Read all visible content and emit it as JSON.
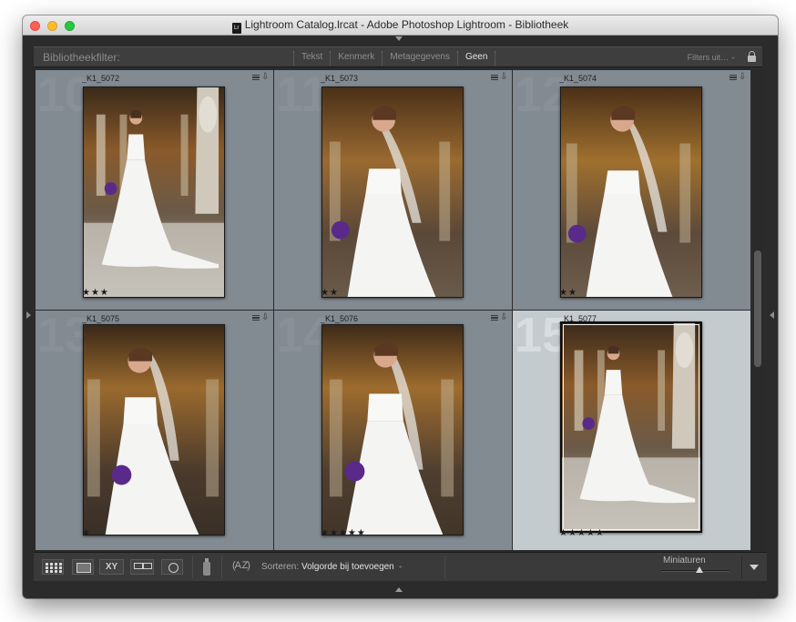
{
  "window": {
    "title": "Lightroom Catalog.lrcat - Adobe Photoshop Lightroom - Bibliotheek",
    "doc_icon_text": "Lr"
  },
  "filter_bar": {
    "label": "Bibliotheekfilter:",
    "tabs": [
      "Tekst",
      "Kenmerk",
      "Metagegevens",
      "Geen"
    ],
    "active_tab": "Geen",
    "filters_off": "Filters uit",
    "filters_off_arrow": "÷",
    "lock_icon": "padlock-icon"
  },
  "grid": {
    "cells": [
      {
        "index": "10",
        "name": "_K1_5072",
        "rating": 3,
        "stars": "★★★",
        "selected": false
      },
      {
        "index": "11",
        "name": "_K1_5073",
        "rating": 2,
        "stars": "★★",
        "selected": false
      },
      {
        "index": "12",
        "name": "_K1_5074",
        "rating": 2,
        "stars": "★★",
        "selected": false
      },
      {
        "index": "13",
        "name": "_K1_5075",
        "rating": 1,
        "stars": "★",
        "selected": false
      },
      {
        "index": "14",
        "name": "_K1_5076",
        "rating": 5,
        "stars": "★★★★★",
        "selected": false
      },
      {
        "index": "15",
        "name": "_K1_5077",
        "rating": 5,
        "stars": "★★★★★",
        "selected": true
      }
    ],
    "badge_arrow": "⇩"
  },
  "toolbar": {
    "compare_label": "XY",
    "sort_icon_text": "A Z",
    "sort_label": "Sorteren:",
    "sort_value": "Volgorde bij toevoegen",
    "sort_arrow": "÷",
    "thumbnails_label": "Miniaturen",
    "thumbnail_slider_value": 0.55
  },
  "colors": {
    "cell_bg": "#828a92",
    "selected_cell_bg": "#c4cbce",
    "chrome_dark": "#2b2b2b"
  }
}
